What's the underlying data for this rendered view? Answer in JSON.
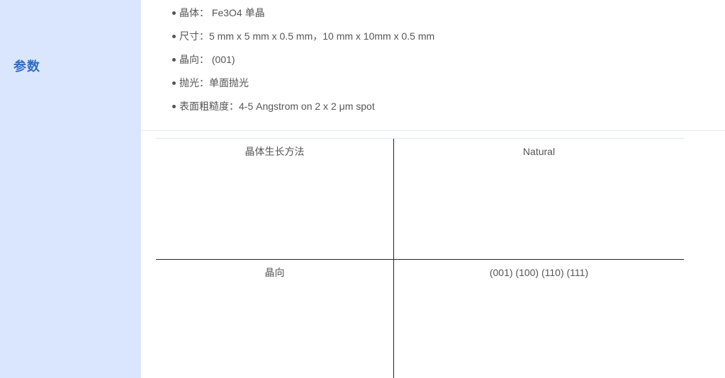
{
  "sidebar": {
    "title": "参数"
  },
  "specs": [
    {
      "label": "晶体：",
      "value": " Fe3O4 单晶"
    },
    {
      "label": "尺寸：",
      "value": "5 mm x 5 mm x 0.5 mm，10 mm x 10mm x 0.5 mm"
    },
    {
      "label": "晶向：",
      "value": " (001)"
    },
    {
      "label": "抛光：",
      "value": "单面抛光"
    },
    {
      "label": "表面粗糙度：",
      "value": "4-5 Angstrom on 2 x 2 μm spot"
    }
  ],
  "table": {
    "rows": [
      {
        "key": "晶体生长方法",
        "value": "Natural"
      },
      {
        "key": "晶向",
        "value": "(001) (100) (110) (111)"
      }
    ]
  }
}
